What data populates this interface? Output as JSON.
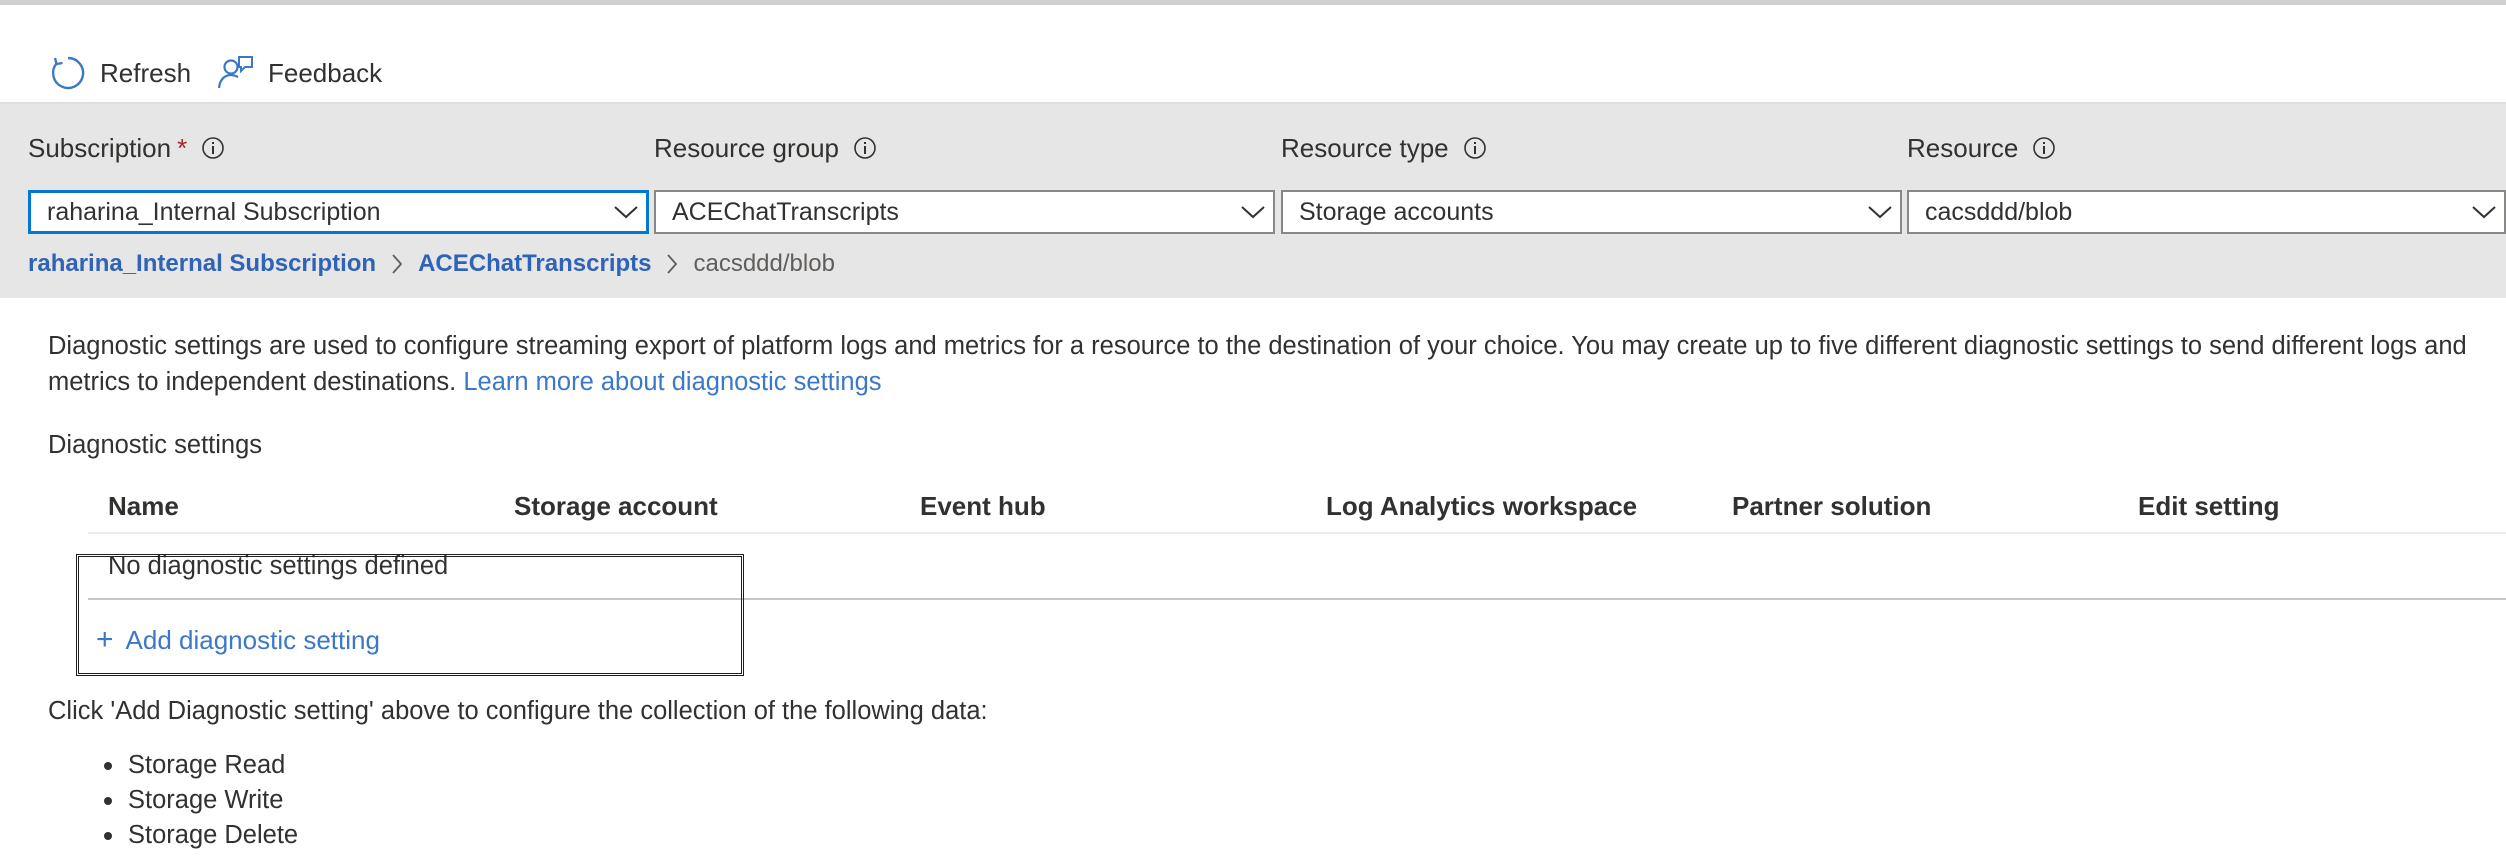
{
  "toolbar": {
    "refresh_label": "Refresh",
    "feedback_label": "Feedback"
  },
  "filters": {
    "subscription": {
      "label": "Subscription",
      "required": "*",
      "value": "raharina_Internal Subscription"
    },
    "resource_group": {
      "label": "Resource group",
      "value": "ACEChatTranscripts"
    },
    "resource_type": {
      "label": "Resource type",
      "value": "Storage accounts"
    },
    "resource": {
      "label": "Resource",
      "value": "cacsddd/blob"
    }
  },
  "breadcrumb": {
    "items": [
      "raharina_Internal Subscription",
      "ACEChatTranscripts"
    ],
    "current": "cacsddd/blob"
  },
  "description": {
    "text": "Diagnostic settings are used to configure streaming export of platform logs and metrics for a resource to the destination of your choice. You may create up to five different diagnostic settings to send different logs and metrics to independent destinations.",
    "link": "Learn more about diagnostic settings"
  },
  "section_title": "Diagnostic settings",
  "table": {
    "columns": [
      "Name",
      "Storage account",
      "Event hub",
      "Log Analytics workspace",
      "Partner solution",
      "Edit setting"
    ],
    "empty_text": "No diagnostic settings defined"
  },
  "add_setting": {
    "icon": "+",
    "label": "Add diagnostic setting"
  },
  "instructions": "Click 'Add Diagnostic setting' above to configure the collection of the following data:",
  "data_items": [
    "Storage Read",
    "Storage Write",
    "Storage Delete"
  ],
  "colors": {
    "link": "#2e63b8",
    "accent": "#0078d4",
    "required": "#a4262c",
    "band": "#e6e6e6"
  }
}
